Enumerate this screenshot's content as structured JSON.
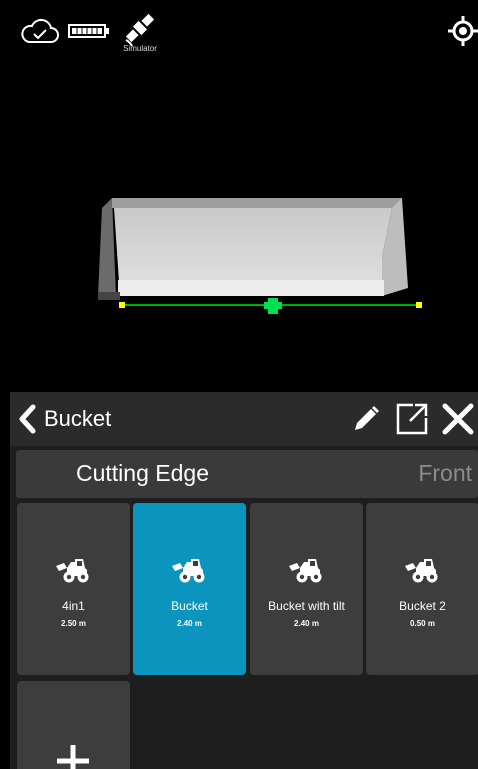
{
  "status": {
    "cloud_icon": "cloud-check-icon",
    "battery_icon": "battery-icon",
    "gnss_icon": "satellite-icon",
    "gnss_label": "Simulator",
    "locate_icon": "locate-target-icon"
  },
  "header": {
    "title": "Bucket",
    "back_icon": "chevron-left-icon",
    "edit_icon": "pencil-icon",
    "open_icon": "external-open-icon",
    "close_icon": "close-icon"
  },
  "tabs": {
    "active": "Cutting Edge",
    "next": "Front"
  },
  "tools": [
    {
      "name": "4in1",
      "width": "2.50 m",
      "selected": false
    },
    {
      "name": "Bucket",
      "width": "2.40 m",
      "selected": true
    },
    {
      "name": "Bucket with tilt",
      "width": "2.40 m",
      "selected": false
    },
    {
      "name": "Bucket 2",
      "width": "0.50 m",
      "selected": false
    }
  ],
  "add_tile": {
    "icon": "plus-icon"
  },
  "colors": {
    "selected_tile": "#0b95be",
    "tile": "#3d3d3d",
    "header": "#2b2b2b",
    "edge_line": "#00b000",
    "marker": "#ffff00",
    "center_marker": "#00e050"
  }
}
